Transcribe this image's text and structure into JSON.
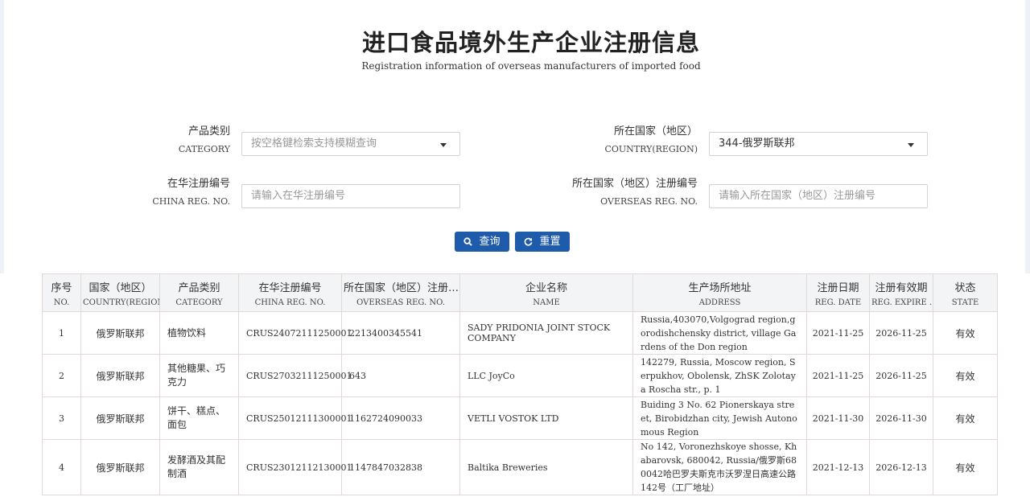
{
  "header": {
    "title": "进口食品境外生产企业注册信息",
    "subtitle": "Registration information of overseas manufacturers of imported food"
  },
  "form": {
    "category": {
      "label_zh": "产品类别",
      "label_en": "CATEGORY",
      "placeholder": "按空格键检索支持模糊查询"
    },
    "country": {
      "label_zh": "所在国家（地区）",
      "label_en": "COUNTRY(REGION)",
      "value": "344-俄罗斯联邦"
    },
    "china_reg": {
      "label_zh": "在华注册编号",
      "label_en": "CHINA REG. NO.",
      "placeholder": "请输入在华注册编号"
    },
    "overseas_reg": {
      "label_zh": "所在国家（地区）注册编号",
      "label_en": "OVERSEAS REG. NO.",
      "placeholder": "请输入所在国家（地区）注册编号"
    },
    "search_label": "查询",
    "reset_label": "重置"
  },
  "table": {
    "columns": [
      {
        "zh": "序号",
        "en": "NO."
      },
      {
        "zh": "国家（地区）",
        "en": "COUNTRY(REGION)"
      },
      {
        "zh": "产品类别",
        "en": "CATEGORY"
      },
      {
        "zh": "在华注册编号",
        "en": "CHINA REG. NO."
      },
      {
        "zh": "所在国家（地区）注册…",
        "en": "OVERSEAS REG. NO."
      },
      {
        "zh": "企业名称",
        "en": "NAME"
      },
      {
        "zh": "生产场所地址",
        "en": "ADDRESS"
      },
      {
        "zh": "注册日期",
        "en": "REG. DATE"
      },
      {
        "zh": "注册有效期",
        "en": "REG. EXPIRE …"
      },
      {
        "zh": "状态",
        "en": "STATE"
      }
    ],
    "rows": [
      {
        "no": "1",
        "country": "俄罗斯联邦",
        "category": "植物饮料",
        "china_reg": "CRUS24072111250001",
        "overseas_reg": "2213400345541",
        "name": "SADY PRIDONIA JOINT STOCK COMPANY",
        "address": "Russia,403070,Volgograd region,gorodishchensky district, village Gardens of the Don region",
        "reg_date": "2021-11-25",
        "expire": "2026-11-25",
        "state": "有效"
      },
      {
        "no": "2",
        "country": "俄罗斯联邦",
        "category": "其他糖果、巧克力",
        "china_reg": "CRUS27032111250001",
        "overseas_reg": "643",
        "name": "LLC JoyCo",
        "address": "142279, Russia, Moscow region, Serpukhov, Obolensk, ZhSK Zolotaya Roscha str., p. 1",
        "reg_date": "2021-11-25",
        "expire": "2026-11-25",
        "state": "有效"
      },
      {
        "no": "3",
        "country": "俄罗斯联邦",
        "category": "饼干、糕点、面包",
        "china_reg": "CRUS25012111300001",
        "overseas_reg": "1162724090033",
        "name": "VETLI VOSTOK LTD",
        "address": "Buiding 3 No. 62 Pionerskaya street, Birobidzhan city, Jewish Autonomous Region",
        "reg_date": "2021-11-30",
        "expire": "2026-11-30",
        "state": "有效"
      },
      {
        "no": "4",
        "country": "俄罗斯联邦",
        "category": "发酵酒及其配制酒",
        "china_reg": "CRUS23012112130001",
        "overseas_reg": "1147847032838",
        "name": "Baltika Breweries",
        "address": "No 142, Voronezhskoye shosse, Khabarovsk, 680042, Russia/俄罗斯680042哈巴罗夫斯克市沃罗涅日高速公路142号（工厂地址）",
        "reg_date": "2021-12-13",
        "expire": "2026-12-13",
        "state": "有效"
      }
    ]
  }
}
